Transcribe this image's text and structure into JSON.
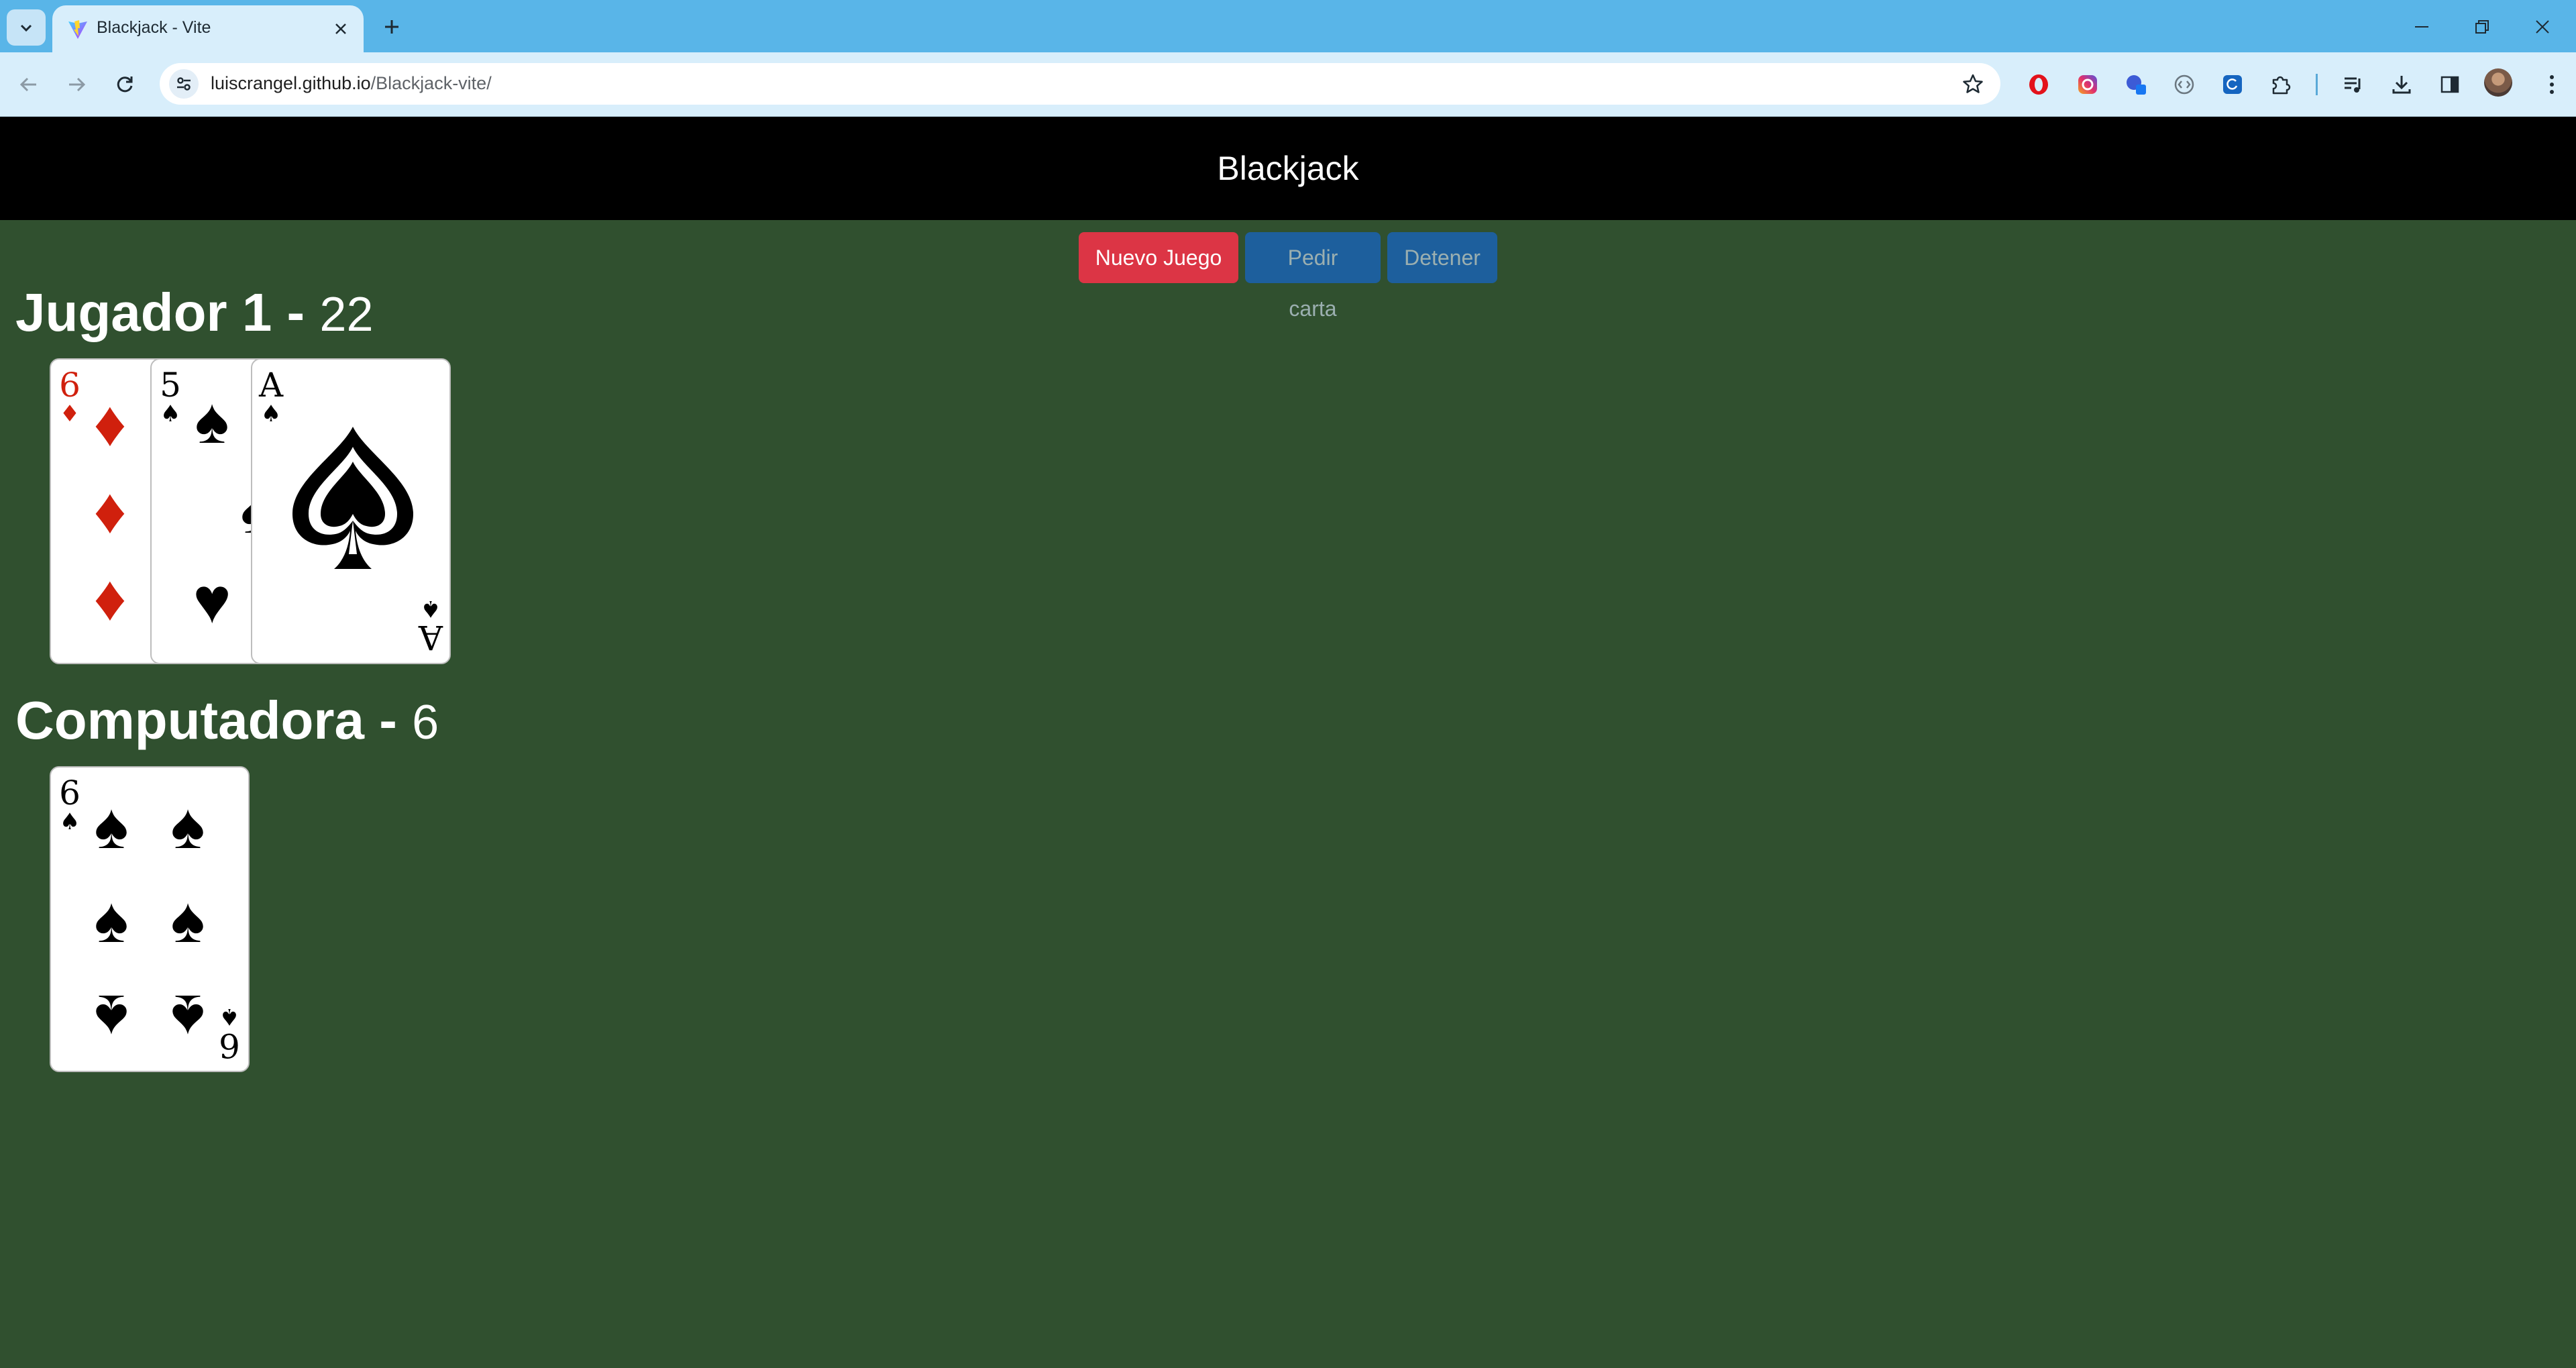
{
  "browser": {
    "tab_title": "Blackjack - Vite",
    "url_domain": "luiscrangel.github.io",
    "url_path": "/Blackjack-vite/"
  },
  "page": {
    "title": "Blackjack",
    "buttons": {
      "new_game": "Nuevo Juego",
      "hit": "Pedir carta",
      "stand": "Detener"
    },
    "player": {
      "heading": "Jugador 1 - ",
      "score": "22",
      "cards": [
        {
          "rank": "6",
          "suit": "♦",
          "color": "red"
        },
        {
          "rank": "5",
          "suit": "♠",
          "color": "black"
        },
        {
          "rank": "A",
          "suit": "♠",
          "color": "black"
        }
      ]
    },
    "computer": {
      "heading": "Computadora - ",
      "score": "6",
      "cards": [
        {
          "rank": "6",
          "suit": "♠",
          "color": "black"
        }
      ]
    }
  },
  "colors": {
    "table_green": "#30502f",
    "header_black": "#000000",
    "danger": "#dc3545",
    "primary": "#1467d8",
    "heart_red": "#d0200d"
  }
}
